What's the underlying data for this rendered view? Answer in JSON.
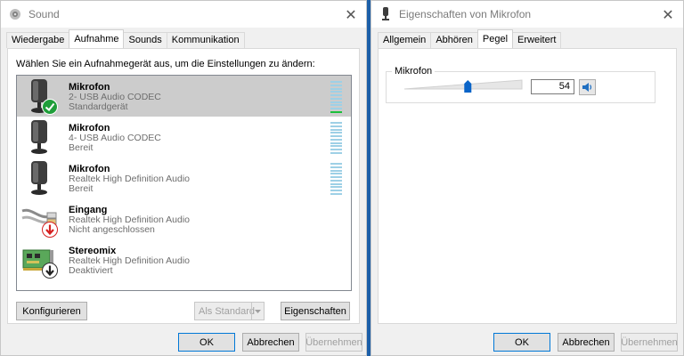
{
  "left": {
    "title": "Sound",
    "tabs": [
      "Wiedergabe",
      "Aufnahme",
      "Sounds",
      "Kommunikation"
    ],
    "active_tab": "Aufnahme",
    "instruction": "Wählen Sie ein Aufnahmegerät aus, um die Einstellungen zu ändern:",
    "devices": [
      {
        "name": "Mikrofon",
        "line1": "2- USB Audio CODEC",
        "line2": "Standardgerät",
        "icon": "microphone-icon",
        "badge": "default-check-icon",
        "selected": true,
        "level": 0.05
      },
      {
        "name": "Mikrofon",
        "line1": "4- USB Audio CODEC",
        "line2": "Bereit",
        "icon": "microphone-icon",
        "badge": "",
        "selected": false,
        "level": 0
      },
      {
        "name": "Mikrofon",
        "line1": "Realtek High Definition Audio",
        "line2": "Bereit",
        "icon": "microphone-icon",
        "badge": "",
        "selected": false,
        "level": 0
      },
      {
        "name": "Eingang",
        "line1": "Realtek High Definition Audio",
        "line2": "Nicht angeschlossen",
        "icon": "line-in-cable-icon",
        "badge": "unplugged-red-arrow-icon",
        "selected": false,
        "level": null
      },
      {
        "name": "Stereomix",
        "line1": "Realtek High Definition Audio",
        "line2": "Deaktiviert",
        "icon": "sound-card-icon",
        "badge": "disabled-down-arrow-icon",
        "selected": false,
        "level": null
      }
    ],
    "configure_label": "Konfigurieren",
    "set_default_label": "Als Standard",
    "properties_label": "Eigenschaften",
    "ok_label": "OK",
    "cancel_label": "Abbrechen",
    "apply_label": "Übernehmen"
  },
  "right": {
    "title": "Eigenschaften von Mikrofon",
    "tabs": [
      "Allgemein",
      "Abhören",
      "Pegel",
      "Erweitert"
    ],
    "active_tab": "Pegel",
    "group_label": "Mikrofon",
    "level_value": "54",
    "level_fraction": 0.54,
    "ok_label": "OK",
    "cancel_label": "Abbrechen",
    "apply_label": "Übernehmen"
  },
  "colors": {
    "selected_row": "#cccccc",
    "meter_bar": "#9ed0e6",
    "meter_level": "#1bbf3a",
    "thumb": "#0a64c8",
    "check_badge": "#1f9e3a",
    "unplugged_badge": "#d62020"
  }
}
